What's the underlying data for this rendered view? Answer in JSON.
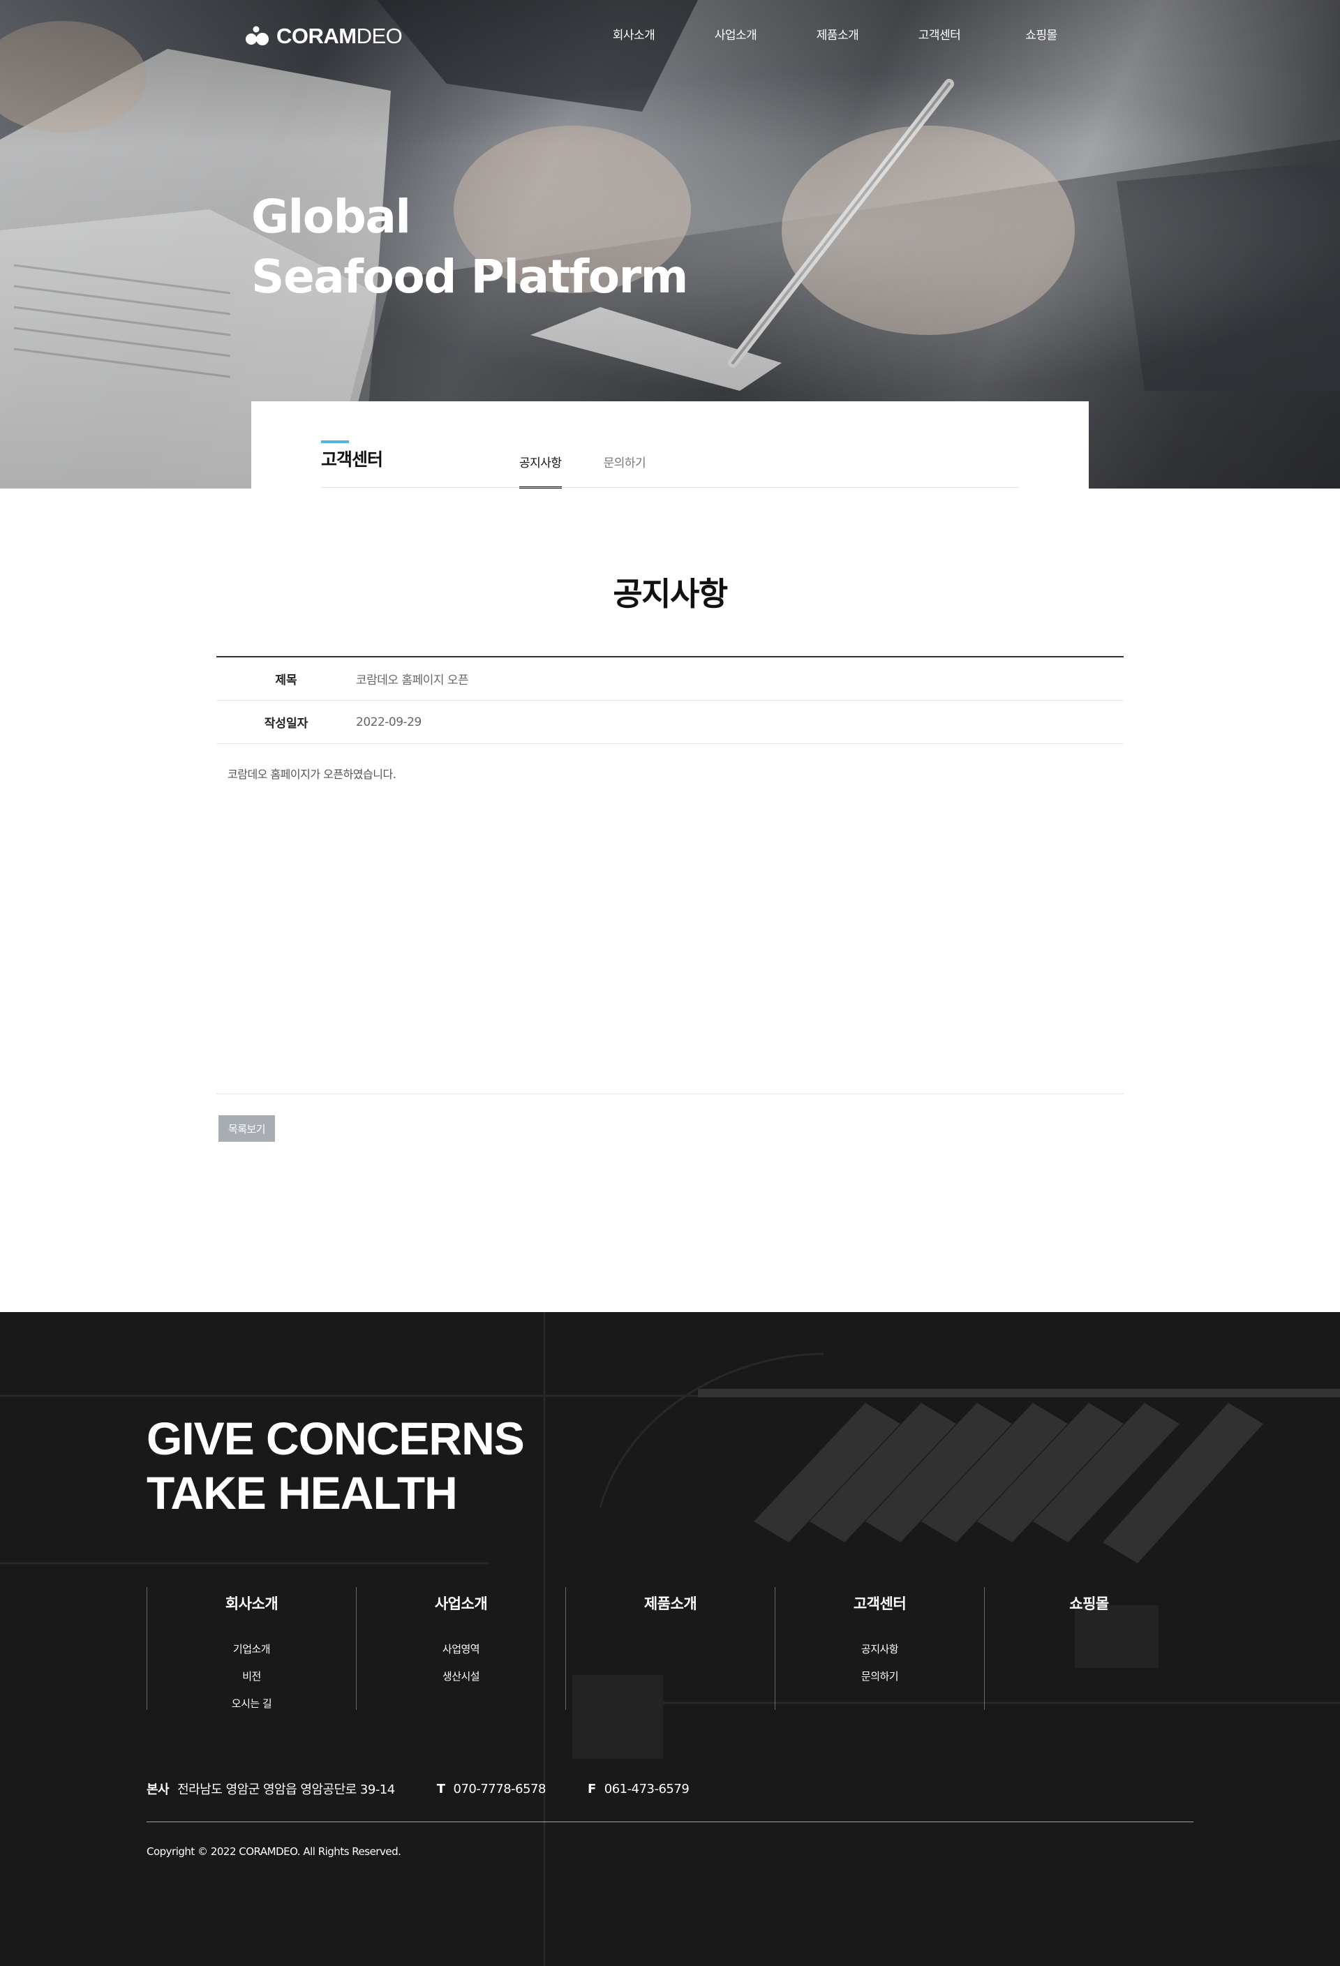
{
  "header": {
    "logo_bold": "CORAM",
    "logo_light": "DEO",
    "nav": [
      "회사소개",
      "사업소개",
      "제품소개",
      "고객센터",
      "쇼핑몰"
    ]
  },
  "hero": {
    "title_line1": "Global",
    "title_line2": "Seafood Platform"
  },
  "subnav": {
    "title": "고객센터",
    "tabs": [
      "공지사항",
      "문의하기"
    ],
    "active_tab": "공지사항"
  },
  "page": {
    "title": "공지사항"
  },
  "post": {
    "subject_label": "제목",
    "subject_value": "코람데오 홈페이지 오픈",
    "date_label": "작성일자",
    "date_value": "2022-09-29",
    "body": "코람데오 홈페이지가 오픈하였습니다."
  },
  "actions": {
    "list_button": "목록보기"
  },
  "footer": {
    "slogan_line1": "GIVE CONCERNS",
    "slogan_line2": "TAKE HEALTH",
    "menu": [
      {
        "title": "회사소개",
        "items": [
          "기업소개",
          "비전",
          "오시는 길"
        ]
      },
      {
        "title": "사업소개",
        "items": [
          "사업영역",
          "생산시설"
        ]
      },
      {
        "title": "제품소개",
        "items": []
      },
      {
        "title": "고객센터",
        "items": [
          "공지사항",
          "문의하기"
        ]
      },
      {
        "title": "쇼핑몰",
        "items": []
      }
    ],
    "address_label": "본사",
    "address": "전라남도 영암군 영암읍 영암공단로 39-14",
    "tel_label": "T",
    "tel": "070-7778-6578",
    "fax_label": "F",
    "fax": "061-473-6579",
    "copyright": "Copyright © 2022 CORAMDEO. All Rights Reserved."
  },
  "colors": {
    "accent": "#4fb8d8",
    "footer_bg": "#1c1c1c",
    "button_bg": "#a8adb3"
  }
}
